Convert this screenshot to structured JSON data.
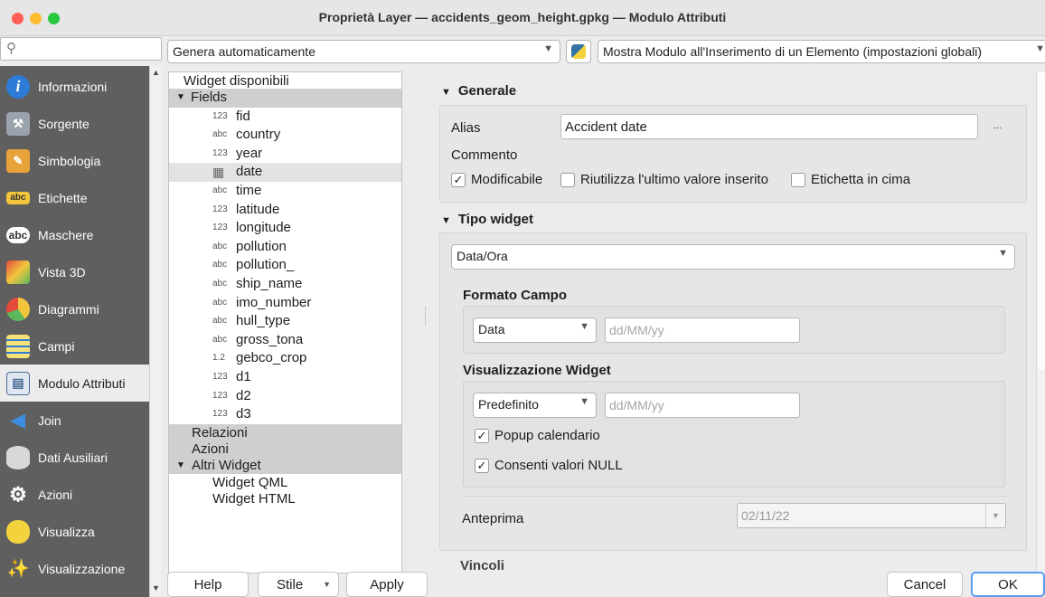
{
  "window": {
    "title": "Proprietà Layer — accidents_geom_height.gpkg — Modulo Attributi"
  },
  "search": {
    "placeholder": ""
  },
  "sidebar": {
    "items": [
      {
        "label": "Informazioni",
        "icon": "info-icon"
      },
      {
        "label": "Sorgente",
        "icon": "source-tools-icon"
      },
      {
        "label": "Simbologia",
        "icon": "paintbrush-icon"
      },
      {
        "label": "Etichette",
        "icon": "label-abc-icon"
      },
      {
        "label": "Maschere",
        "icon": "mask-abc-icon"
      },
      {
        "label": "Vista 3D",
        "icon": "cube-3d-icon"
      },
      {
        "label": "Diagrammi",
        "icon": "diagram-icon"
      },
      {
        "label": "Campi",
        "icon": "fields-icon"
      },
      {
        "label": "Modulo Attributi",
        "icon": "form-icon"
      },
      {
        "label": "Join",
        "icon": "join-icon"
      },
      {
        "label": "Dati Ausiliari",
        "icon": "database-icon"
      },
      {
        "label": "Azioni",
        "icon": "actions-gear-icon"
      },
      {
        "label": "Visualizza",
        "icon": "speech-bubble-icon"
      },
      {
        "label": "Visualizzazione",
        "icon": "rendering-brush-icon"
      }
    ],
    "selected_index": 8
  },
  "toolbar": {
    "layout_mode": "Genera automaticamente",
    "form_popup": "Mostra Modulo all'Inserimento di un Elemento (impostazioni globali)"
  },
  "tree": {
    "header": "Widget disponibili",
    "fields_label": "Fields",
    "fields": [
      {
        "type": "123",
        "name": "fid"
      },
      {
        "type": "abc",
        "name": "country"
      },
      {
        "type": "123",
        "name": "year"
      },
      {
        "type": "cal",
        "name": "date"
      },
      {
        "type": "abc",
        "name": "time"
      },
      {
        "type": "123",
        "name": "latitude"
      },
      {
        "type": "123",
        "name": "longitude"
      },
      {
        "type": "abc",
        "name": "pollution"
      },
      {
        "type": "abc",
        "name": "pollution_"
      },
      {
        "type": "abc",
        "name": "ship_name"
      },
      {
        "type": "abc",
        "name": "imo_number"
      },
      {
        "type": "abc",
        "name": "hull_type"
      },
      {
        "type": "abc",
        "name": "gross_tona"
      },
      {
        "type": "1.2",
        "name": "gebco_crop"
      },
      {
        "type": "123",
        "name": "d1"
      },
      {
        "type": "123",
        "name": "d2"
      },
      {
        "type": "123",
        "name": "d3"
      }
    ],
    "relazioni": "Relazioni",
    "azioni": "Azioni",
    "altri": "Altri Widget",
    "altri_items": [
      "Widget QML",
      "Widget HTML"
    ]
  },
  "generale": {
    "header": "Generale",
    "alias_label": "Alias",
    "alias_value": "Accident date",
    "more": "...",
    "commento_label": "Commento",
    "modificabile": "Modificabile",
    "riutilizza": "Riutilizza l'ultimo valore inserito",
    "etichetta": "Etichetta in cima"
  },
  "tipo_widget": {
    "header": "Tipo widget",
    "value": "Data/Ora",
    "formato_header": "Formato Campo",
    "formato_value": "Data",
    "formato_placeholder": "dd/MM/yy",
    "visual_header": "Visualizzazione Widget",
    "visual_value": "Predefinito",
    "visual_placeholder": "dd/MM/yy",
    "popup_label": "Popup calendario",
    "null_label": "Consenti valori NULL",
    "anteprima_label": "Anteprima",
    "anteprima_value": "02/11/22"
  },
  "cut_off_header": "Vincoli",
  "buttons": {
    "help": "Help",
    "stile": "Stile",
    "apply": "Apply",
    "cancel": "Cancel",
    "ok": "OK"
  }
}
